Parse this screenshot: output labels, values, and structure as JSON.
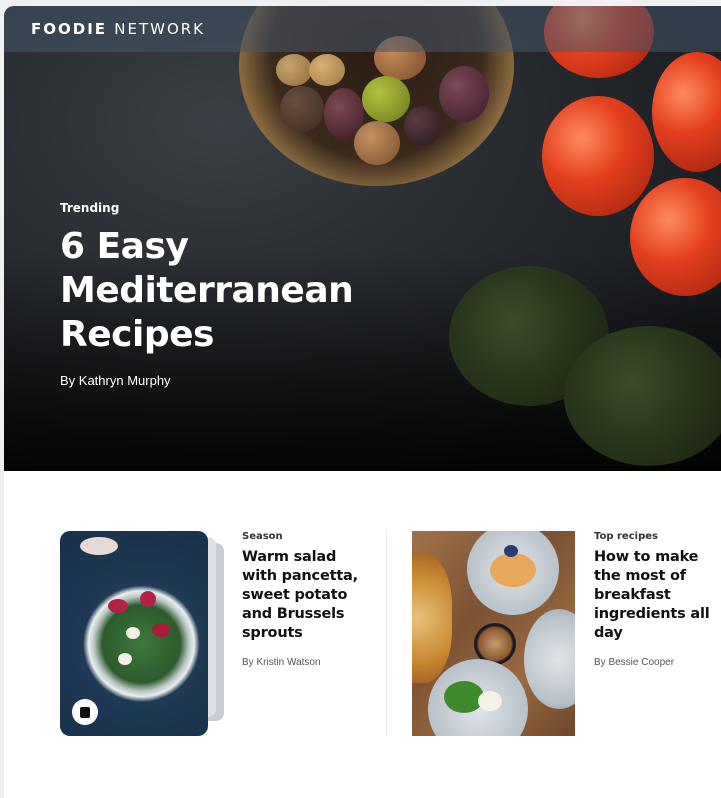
{
  "brand": {
    "bold": "FOODIE",
    "light": "NETWORK"
  },
  "hero": {
    "eyebrow": "Trending",
    "title": "6 Easy Mediterranean Recipes",
    "author": "By Kathryn Murphy"
  },
  "cards": [
    {
      "tag": "Season",
      "title": "Warm salad with pancetta, sweet potato and Brussels sprouts",
      "author": "By Kristin Watson",
      "icon": "stack-play-icon"
    },
    {
      "tag": "Top recipes",
      "title": "How to make the most of breakfast ingredients all day",
      "author": "By Bessie Cooper"
    }
  ]
}
